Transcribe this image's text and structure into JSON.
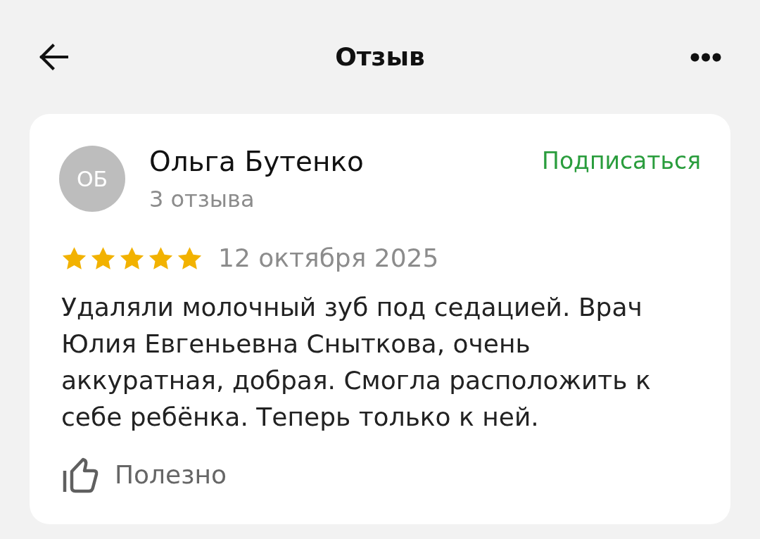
{
  "header": {
    "title": "Отзыв"
  },
  "review": {
    "author": {
      "initials": "ОБ",
      "name": "Ольга Бутенко",
      "reviews_count": "3 отзыва"
    },
    "subscribe_button": "Подписаться",
    "stars": 5,
    "date": "12 октября 2025",
    "text": "Удаляли молочный зуб под седацией. Врач Юлия Евгеньевна Сныткова, очень аккуратная, добрая. Смогла расположить к себе ребёнка. Теперь только к ней.",
    "helpful_button": "Полезно"
  }
}
